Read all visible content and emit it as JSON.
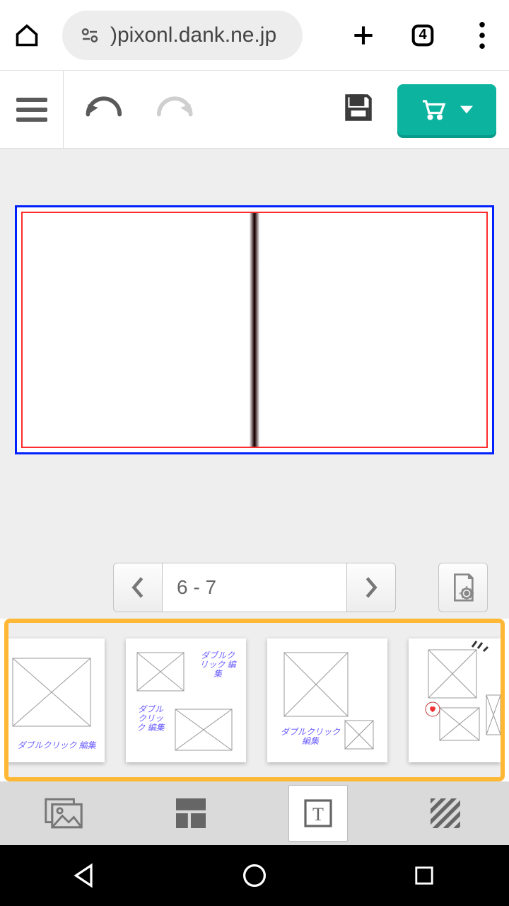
{
  "browser": {
    "url_display": ")pixonl.dank.ne.jp",
    "tab_count": "4"
  },
  "toolbar": {
    "menu_icon": "hamburger-icon",
    "undo_icon": "undo-icon",
    "redo_icon": "redo-icon",
    "save_icon": "save-icon",
    "cart_icon": "cart-icon"
  },
  "pager": {
    "current_pages": "6 - 7"
  },
  "templates": {
    "items": [
      {
        "caption": "ダブルクリック 編集"
      },
      {
        "caption_a": "ダブルクリック 編集",
        "caption_b": "ダブルクリック 編集"
      },
      {
        "caption": "ダブルクリック 編集"
      },
      {
        "caption": ""
      }
    ]
  },
  "colors": {
    "accent": "#0cb4a0",
    "highlight_border": "#ffb836",
    "canvas_outer": "#0020ff",
    "canvas_inner": "#ff2a2a"
  }
}
